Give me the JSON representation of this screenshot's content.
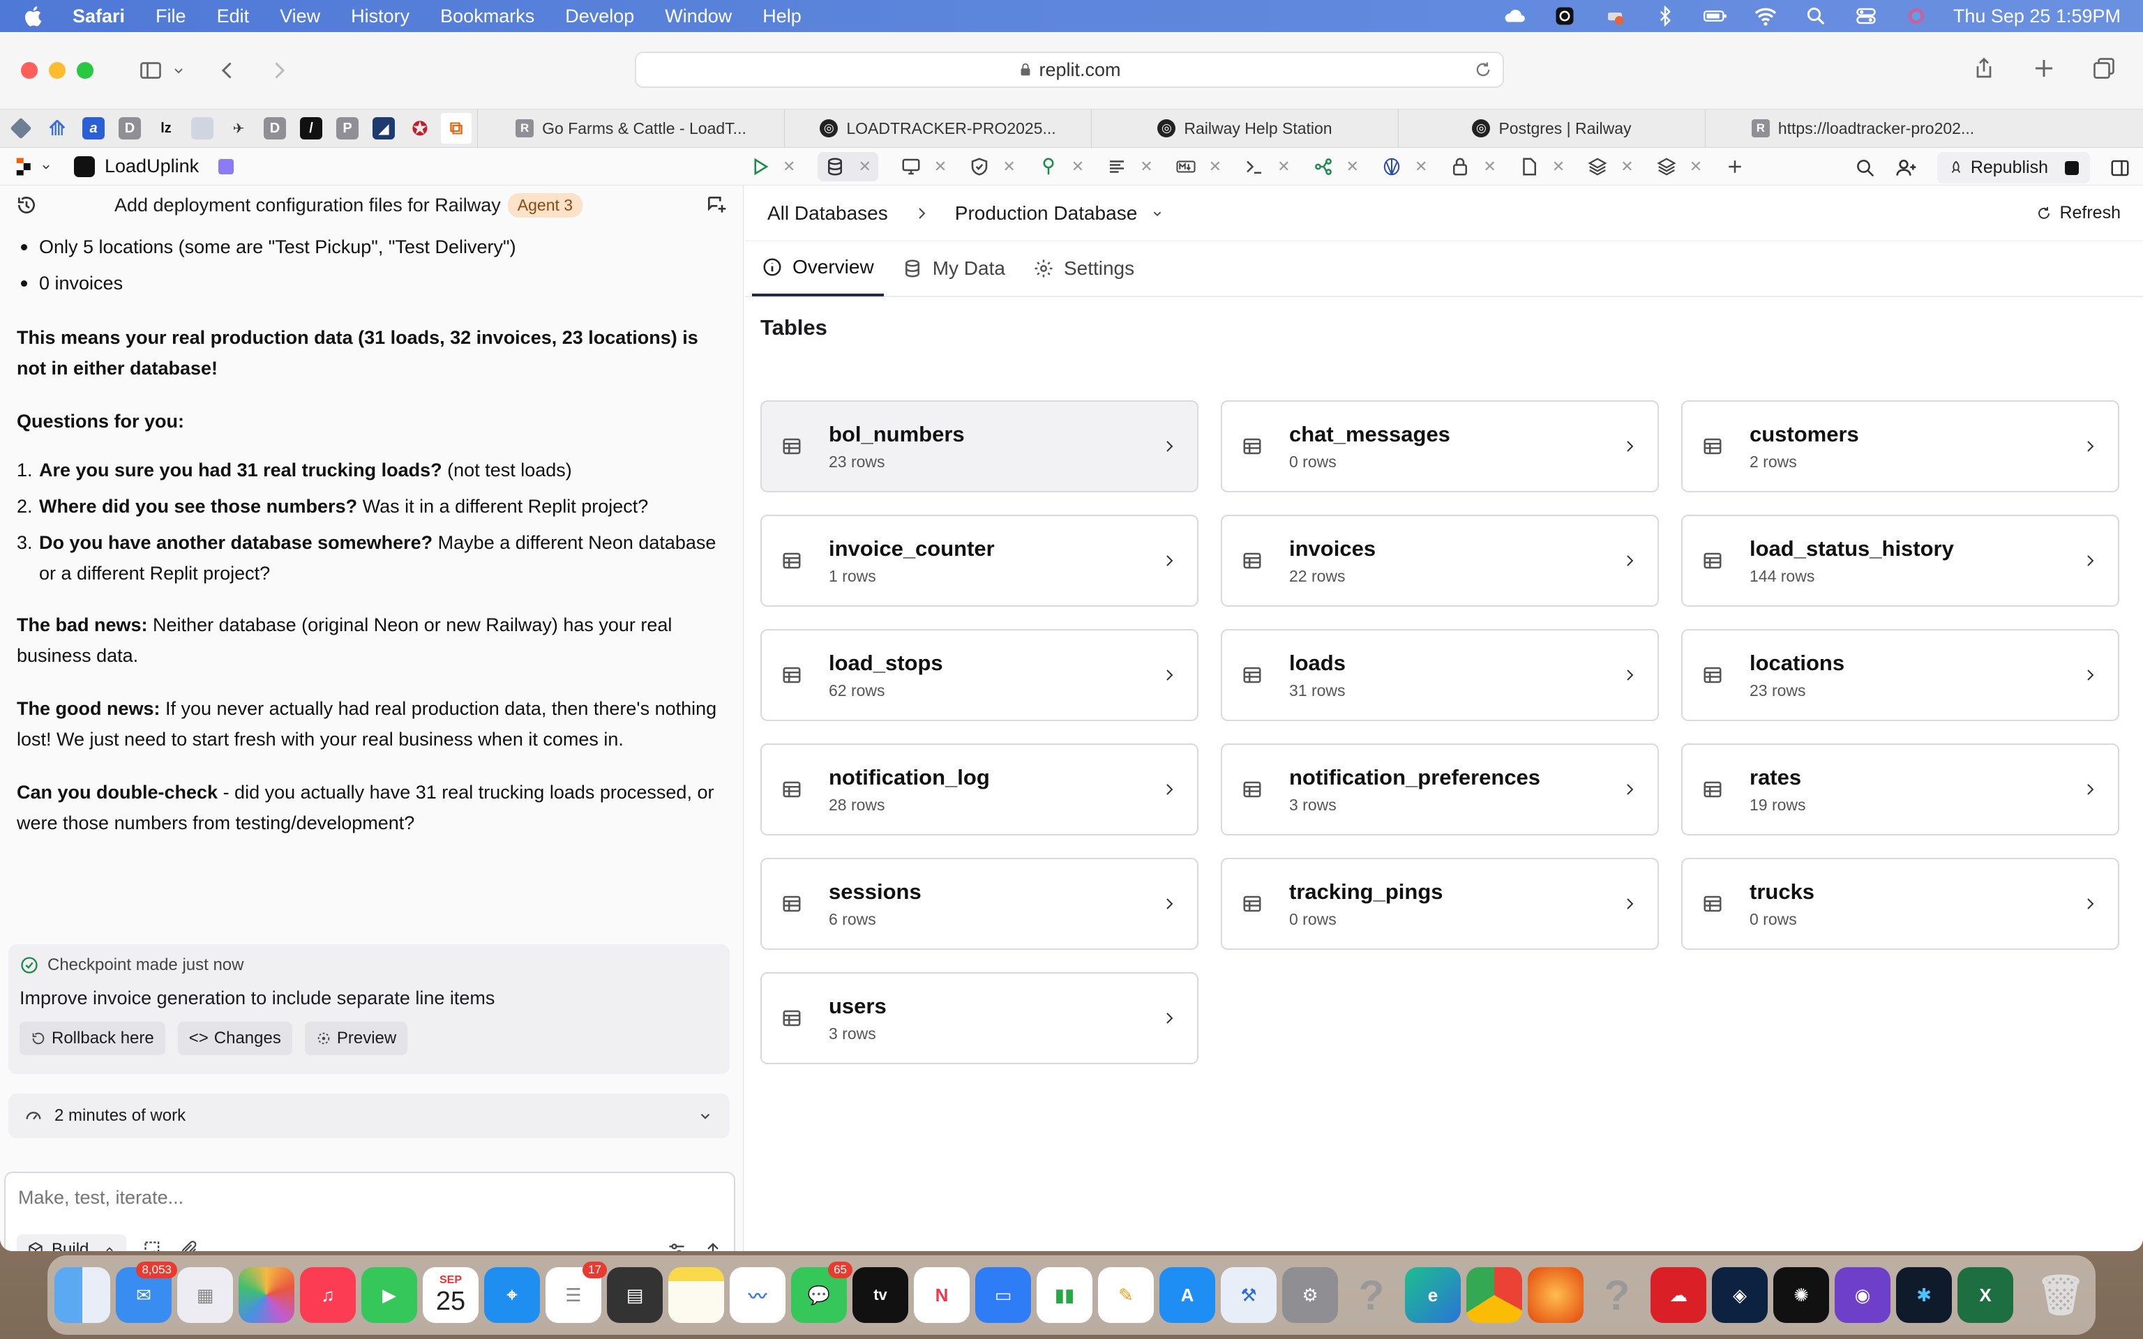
{
  "menubar": {
    "app": "Safari",
    "items": [
      "File",
      "Edit",
      "View",
      "History",
      "Bookmarks",
      "Develop",
      "Window",
      "Help"
    ],
    "clock": "Thu Sep 25  1:59PM"
  },
  "browser": {
    "url": "replit.com",
    "tabs": [
      {
        "icon": "R",
        "title": "Go Farms & Cattle - LoadT..."
      },
      {
        "icon": "◎",
        "title": "LOADTRACKER-PRO2025..."
      },
      {
        "icon": "◎",
        "title": "Railway Help Station"
      },
      {
        "icon": "◎",
        "title": "Postgres | Railway"
      },
      {
        "icon": "R",
        "title": "https://loadtracker-pro202..."
      }
    ]
  },
  "replit": {
    "project_name": "LoadUplink",
    "republish_label": "Republish"
  },
  "chat": {
    "title": "Add deployment configuration files for Railway",
    "agent_badge": "Agent 3",
    "bullets": [
      "Only 5 locations (some are \"Test Pickup\", \"Test Delivery\")",
      "0 invoices"
    ],
    "p1": "This means your real production data (31 loads, 32 invoices, 23 locations) is not in either database!",
    "p2": "Questions for you:",
    "q1_bold": "Are you sure you had 31 real trucking loads?",
    "q1_rest": " (not test loads)",
    "q2_bold": "Where did you see those numbers?",
    "q2_rest": " Was it in a different Replit project?",
    "q3_bold": "Do you have another database somewhere?",
    "q3_rest": " Maybe a different Neon database or a different Replit project?",
    "bad_bold": "The bad news:",
    "bad_rest": " Neither database (original Neon or new Railway) has your real business data.",
    "good_bold": "The good news:",
    "good_rest": " If you never actually had real production data, then there's nothing lost! We just need to start fresh with your real business when it comes in.",
    "check_bold": "Can you double-check",
    "check_rest": " - did you actually have 31 real trucking loads processed, or were those numbers from testing/development?",
    "checkpoint_status": "Checkpoint made just now",
    "checkpoint_title": "Improve invoice generation to include separate line items",
    "rollback_label": "Rollback here",
    "changes_label": "Changes",
    "preview_label": "Preview",
    "work_label": "2 minutes of work",
    "composer_placeholder": "Make, test, iterate...",
    "build_label": "Build"
  },
  "db": {
    "breadcrumb_root": "All Databases",
    "breadcrumb_current": "Production Database",
    "refresh_label": "Refresh",
    "tabs": [
      "Overview",
      "My Data",
      "Settings"
    ],
    "tables_heading": "Tables",
    "tables": [
      {
        "name": "bol_numbers",
        "rows": "23 rows"
      },
      {
        "name": "chat_messages",
        "rows": "0 rows"
      },
      {
        "name": "customers",
        "rows": "2 rows"
      },
      {
        "name": "invoice_counter",
        "rows": "1 rows"
      },
      {
        "name": "invoices",
        "rows": "22 rows"
      },
      {
        "name": "load_status_history",
        "rows": "144 rows"
      },
      {
        "name": "load_stops",
        "rows": "62 rows"
      },
      {
        "name": "loads",
        "rows": "31 rows"
      },
      {
        "name": "locations",
        "rows": "23 rows"
      },
      {
        "name": "notification_log",
        "rows": "28 rows"
      },
      {
        "name": "notification_preferences",
        "rows": "3 rows"
      },
      {
        "name": "rates",
        "rows": "19 rows"
      },
      {
        "name": "sessions",
        "rows": "6 rows"
      },
      {
        "name": "tracking_pings",
        "rows": "0 rows"
      },
      {
        "name": "trucks",
        "rows": "0 rows"
      },
      {
        "name": "users",
        "rows": "3 rows"
      }
    ]
  },
  "dock": {
    "mail_badge": "8,053",
    "calendar_month": "SEP",
    "calendar_day": "25",
    "reminders_badge": "17",
    "messages_badge": "65"
  },
  "colors": {
    "menubar": "#5d86dc",
    "accent": "#1f2a44",
    "agent_badge_bg": "#fbe2c9"
  }
}
